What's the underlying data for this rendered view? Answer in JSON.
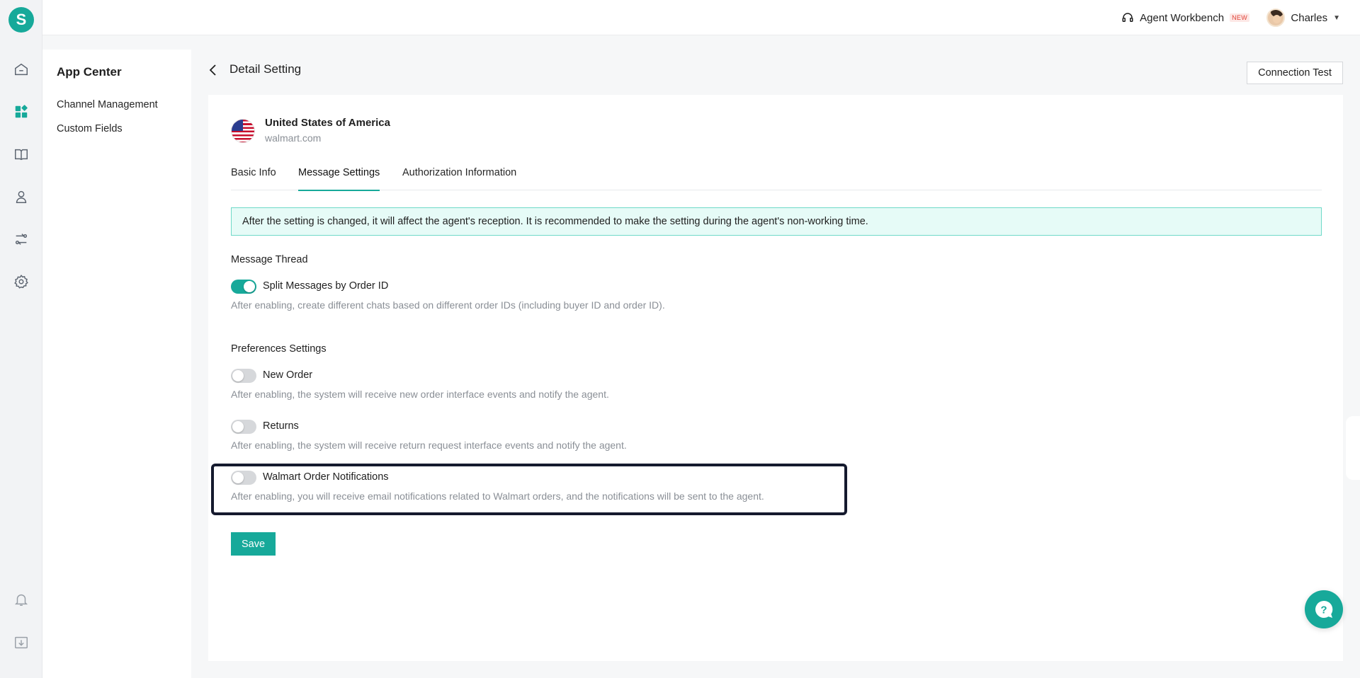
{
  "app": {
    "logo_letter": "S",
    "accent_color": "#17a99a"
  },
  "rail": {
    "icons": [
      "home-icon",
      "app-center-icon",
      "book-icon",
      "user-icon",
      "routing-icon",
      "settings-icon",
      "bell-icon",
      "download-icon"
    ]
  },
  "header": {
    "workbench_label": "Agent Workbench",
    "workbench_badge": "NEW",
    "user_name": "Charles"
  },
  "sidebar": {
    "title": "App Center",
    "items": [
      {
        "label": "Channel Management"
      },
      {
        "label": "Custom Fields"
      }
    ]
  },
  "page": {
    "title": "Detail Setting",
    "connection_test_label": "Connection Test"
  },
  "store": {
    "country": "United States of America",
    "domain": "walmart.com"
  },
  "tabs": [
    {
      "label": "Basic Info",
      "active": false
    },
    {
      "label": "Message Settings",
      "active": true
    },
    {
      "label": "Authorization Information",
      "active": false
    }
  ],
  "notice": "After the setting is changed, it will affect the agent's reception. It is recommended to make the setting during the agent's non-working time.",
  "message_thread": {
    "title": "Message Thread",
    "options": [
      {
        "label": "Split Messages by Order ID",
        "enabled": true,
        "description": "After enabling, create different chats based on different order IDs (including buyer ID and order ID)."
      }
    ]
  },
  "preferences": {
    "title": "Preferences Settings",
    "options": [
      {
        "label": "New Order",
        "enabled": false,
        "description": "After enabling, the system will receive new order interface events and notify the agent."
      },
      {
        "label": "Returns",
        "enabled": false,
        "description": "After enabling, the system will receive return request interface events and notify the agent."
      },
      {
        "label": "Walmart Order Notifications",
        "enabled": false,
        "description": "After enabling, you will receive email notifications related to Walmart orders, and the notifications will be sent to the agent."
      }
    ]
  },
  "actions": {
    "save_label": "Save"
  }
}
